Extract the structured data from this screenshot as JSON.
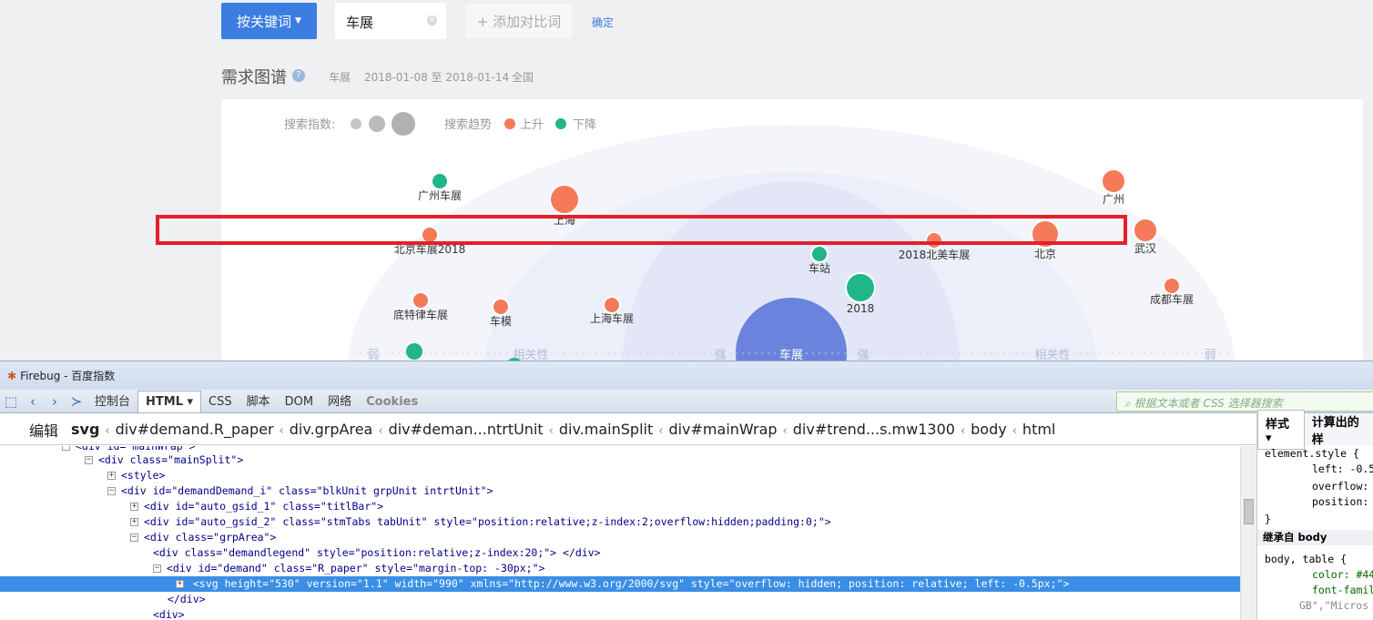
{
  "toolbar": {
    "keyword_button": "按关键词",
    "search_term": "车展",
    "add_compare": "+ 添加对比词",
    "confirm": "确定"
  },
  "section": {
    "title": "需求图谱",
    "help_icon": "?",
    "term": "车展",
    "date_range": "2018-01-08 至 2018-01-14",
    "region": "全国"
  },
  "legend": {
    "index_label": "搜索指数:",
    "trend_label": "搜索趋势",
    "up_label": "上升",
    "down_label": "下降",
    "up_color": "#f57a5a",
    "down_color": "#21b58a"
  },
  "axis": {
    "weak": "弱",
    "relevance": "相关性",
    "strong": "强"
  },
  "graph": {
    "center": "车展",
    "nodes": [
      {
        "label": "广州车展",
        "trend": "down"
      },
      {
        "label": "上海",
        "trend": "up"
      },
      {
        "label": "北京车展2018",
        "trend": "up"
      },
      {
        "label": "底特律车展",
        "trend": "up"
      },
      {
        "label": "车模",
        "trend": "up"
      },
      {
        "label": "上海车展",
        "trend": "up"
      },
      {
        "label": "车站",
        "trend": "down"
      },
      {
        "label": "2018",
        "trend": "down"
      },
      {
        "label": "2018北美车展",
        "trend": "up"
      },
      {
        "label": "北京",
        "trend": "up"
      },
      {
        "label": "广州",
        "trend": "up"
      },
      {
        "label": "武汉",
        "trend": "up"
      },
      {
        "label": "成都车展",
        "trend": "up"
      }
    ]
  },
  "firebug": {
    "title": "Firebug - 百度指数",
    "tabs": [
      "控制台",
      "HTML",
      "CSS",
      "脚本",
      "DOM",
      "网络",
      "Cookies"
    ],
    "search_placeholder": "根据文本或者 CSS 选择器搜索",
    "edit": "编辑",
    "breadcrumbs": [
      "svg",
      "div#demand.R_paper",
      "div.grpArea",
      "div#deman...ntrtUnit",
      "div.mainSplit",
      "div#mainWrap",
      "div#trend...s.mw1300",
      "body",
      "html"
    ],
    "side_tabs": [
      "样式",
      "计算出的样"
    ],
    "tree_lines": [
      "<div id=\"mainWrap\">",
      "<div class=\"mainSplit\">",
      "<style>",
      "<div id=\"demandDemand_i\" class=\"blkUnit grpUnit intrtUnit\">",
      "<div id=\"auto_gsid_1\" class=\"titlBar\">",
      "<div id=\"auto_gsid_2\" class=\"stmTabs tabUnit\" style=\"position:relative;z-index:2;overflow:hidden;padding:0;\">",
      "<div class=\"grpArea\">",
      "<div class=\"demandlegend\" style=\"position:relative;z-index:20;\"> </div>",
      "<div id=\"demand\" class=\"R_paper\" style=\"margin-top: -30px;\">",
      "<svg height=\"530\" version=\"1.1\" width=\"990\" xmlns=\"http://www.w3.org/2000/svg\" style=\"overflow: hidden; position: relative; left: -0.5px;\">",
      "</div>",
      "<div>"
    ],
    "style_lines": [
      "element.style {",
      "left: -0.5",
      "overflow:",
      "position:",
      "}",
      "继承自 body",
      "body, table {",
      "color: #44",
      "font-famil",
      "GB\",\"Micros"
    ]
  }
}
